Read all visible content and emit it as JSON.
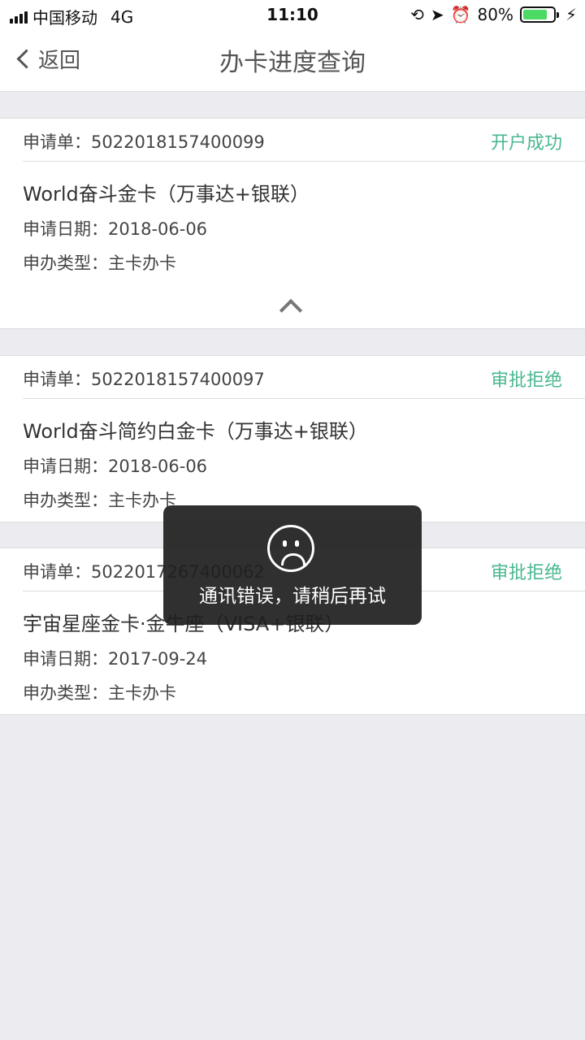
{
  "status_bar": {
    "carrier": "中国移动",
    "network": "4G",
    "time": "11:10",
    "battery": "80%",
    "battery_level": 0.8
  },
  "nav": {
    "back_label": "返回",
    "title": "办卡进度查询"
  },
  "labels": {
    "application": "申请单：",
    "date": "申请日期：",
    "type": "申办类型："
  },
  "applications": [
    {
      "number": "5022018157400099",
      "status": "开户成功",
      "card_name": "World奋斗金卡（万事达+银联）",
      "date": "2018-06-06",
      "type": "主卡办卡"
    },
    {
      "number": "5022018157400097",
      "status": "审批拒绝",
      "card_name": "World奋斗简约白金卡（万事达+银联）",
      "date": "2018-06-06",
      "type": "主卡办卡"
    },
    {
      "number": "5022017267400062",
      "status": "审批拒绝",
      "card_name": "宇宙星座金卡·金牛座（VISA+银联）",
      "date": "2017-09-24",
      "type": "主卡办卡"
    }
  ],
  "toast": {
    "message": "通讯错误，请稍后再试",
    "icon": "sad-face-icon"
  },
  "colors": {
    "status_green": "#49b88f",
    "background": "#ebebf0"
  }
}
